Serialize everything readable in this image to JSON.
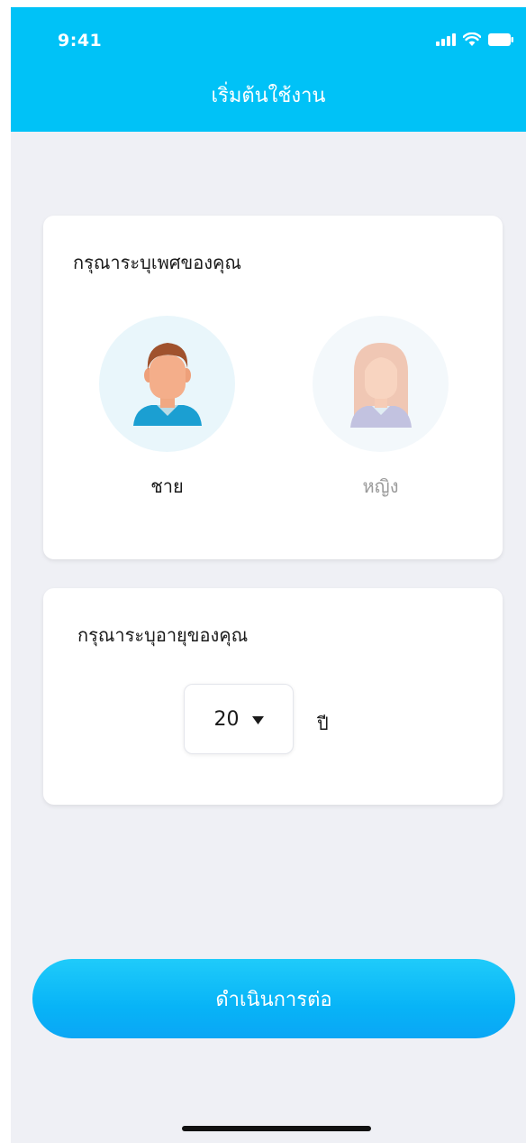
{
  "status_bar": {
    "time": "9:41",
    "icons": [
      "signal-icon",
      "wifi-icon",
      "battery-icon"
    ]
  },
  "header": {
    "title": "เริ่มต้นใช้งาน"
  },
  "gender_card": {
    "title": "กรุณาระบุเพศของคุณ",
    "options": [
      {
        "label": "ชาย",
        "selected": true
      },
      {
        "label": "หญิง",
        "selected": false
      }
    ]
  },
  "age_card": {
    "title": "กรุณาระบุอายุของคุณ",
    "selected_age": "20",
    "unit": "ปี"
  },
  "continue_button": {
    "label": "ดำเนินการต่อ"
  },
  "colors": {
    "header": "#00c2f7",
    "background": "#eff0f5",
    "button": "#08b4f7",
    "selected_text": "#1a1a1a",
    "unselected_text": "#9a9a9a"
  }
}
